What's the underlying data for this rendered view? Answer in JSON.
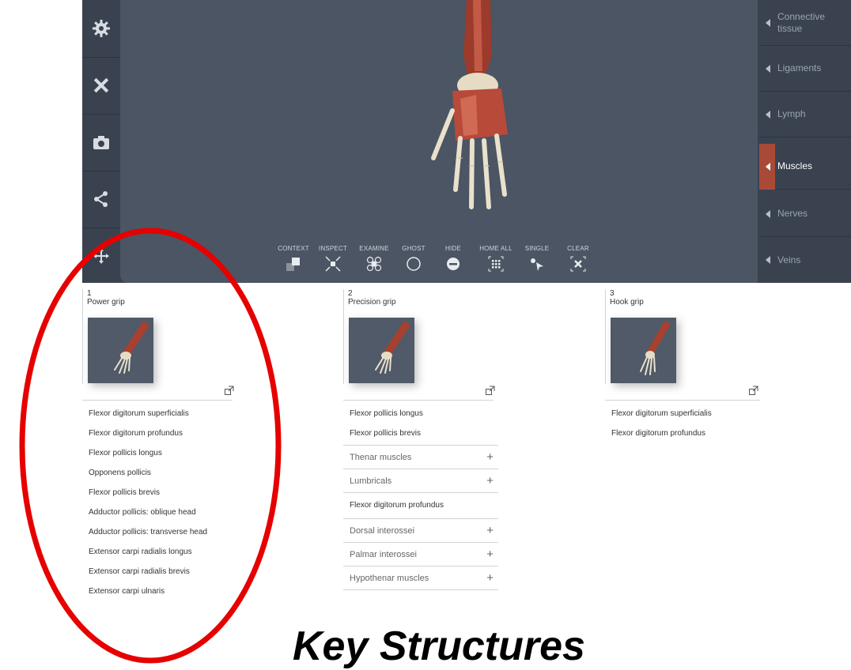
{
  "left_toolbar": {
    "icons": [
      "gear-icon",
      "pencil-ruler-icon",
      "camera-icon",
      "share-icon",
      "move-icon"
    ]
  },
  "layer_tabs": [
    {
      "label": "Connective tissue",
      "active": false
    },
    {
      "label": "Ligaments",
      "active": false
    },
    {
      "label": "Lymph",
      "active": false
    },
    {
      "label": "Muscles",
      "active": true
    },
    {
      "label": "Nerves",
      "active": false
    },
    {
      "label": "Veins",
      "active": false
    }
  ],
  "bottom_toolbar": [
    {
      "label": "CONTEXT",
      "icon": "context-icon"
    },
    {
      "label": "INSPECT",
      "icon": "inspect-icon"
    },
    {
      "label": "EXAMINE",
      "icon": "examine-icon"
    },
    {
      "label": "GHOST",
      "icon": "ghost-icon"
    },
    {
      "label": "HIDE",
      "icon": "hide-icon"
    },
    {
      "label": "HOME ALL",
      "icon": "home-all-icon"
    },
    {
      "label": "SINGLE",
      "icon": "single-select-icon"
    },
    {
      "label": "CLEAR",
      "icon": "clear-icon"
    }
  ],
  "grips": [
    {
      "number": "1",
      "title": "Power grip",
      "items": [
        "Flexor digitorum superficialis",
        "Flexor digitorum profundus",
        "Flexor pollicis longus",
        "Opponens pollicis",
        "Flexor pollicis brevis",
        "Adductor pollicis: oblique head",
        "Adductor pollicis: transverse head",
        "Extensor carpi radialis longus",
        "Extensor carpi radialis brevis",
        "Extensor carpi ulnaris"
      ]
    },
    {
      "number": "2",
      "title": "Precision grip",
      "items": [
        {
          "type": "item",
          "label": "Flexor pollicis longus"
        },
        {
          "type": "item",
          "label": "Flexor pollicis brevis"
        },
        {
          "type": "group",
          "label": "Thenar muscles",
          "action": "+"
        },
        {
          "type": "group",
          "label": "Lumbricals",
          "action": "+"
        },
        {
          "type": "item",
          "label": "Flexor digitorum profundus"
        },
        {
          "type": "group",
          "label": "Dorsal interossei",
          "action": "+"
        },
        {
          "type": "group",
          "label": "Palmar interossei",
          "action": "+"
        },
        {
          "type": "group",
          "label": "Hypothenar muscles",
          "action": "+"
        }
      ]
    },
    {
      "number": "3",
      "title": "Hook grip",
      "items": [
        "Flexor digitorum superficialis",
        "Flexor digitorum profundus"
      ]
    }
  ],
  "annotation": {
    "title": "Key Structures",
    "ellipse_color": "#e60000"
  },
  "colors": {
    "accent": "#a94a38",
    "viewer_bg": "#4b5563",
    "frame_bg": "#3a4250"
  }
}
